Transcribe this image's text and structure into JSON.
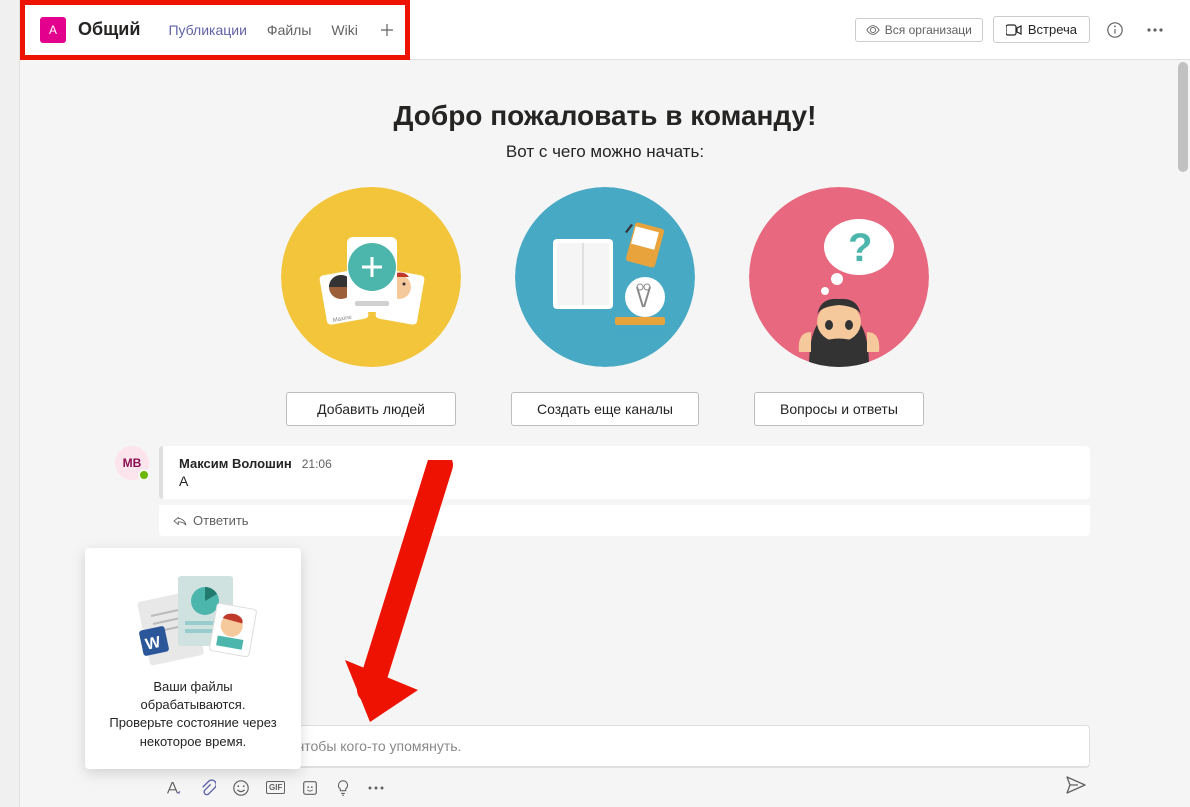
{
  "header": {
    "team_avatar_letter": "A",
    "channel_name": "Общий",
    "tabs": {
      "posts": "Публикации",
      "files": "Файлы",
      "wiki": "Wiki"
    },
    "org_button": "Вся организаци",
    "meet_button": "Встреча"
  },
  "welcome": {
    "title": "Добро пожаловать в команду!",
    "subtitle": "Вот с чего можно начать:",
    "actions": {
      "add_people": "Добавить людей",
      "create_channels": "Создать еще каналы",
      "faq": "Вопросы и ответы"
    }
  },
  "message": {
    "avatar_initials": "МВ",
    "author": "Максим Волошин",
    "time": "21:06",
    "text": "A",
    "reply_label": "Ответить"
  },
  "popup": {
    "line1": "Ваши файлы",
    "line2": "обрабатываются.",
    "line3": "Проверьте состояние через",
    "line4": "некоторое время."
  },
  "compose": {
    "visible_text_fragment": "у. Используйте @, чтобы кого-то упомянуть."
  },
  "toolbar_gif": "GIF"
}
